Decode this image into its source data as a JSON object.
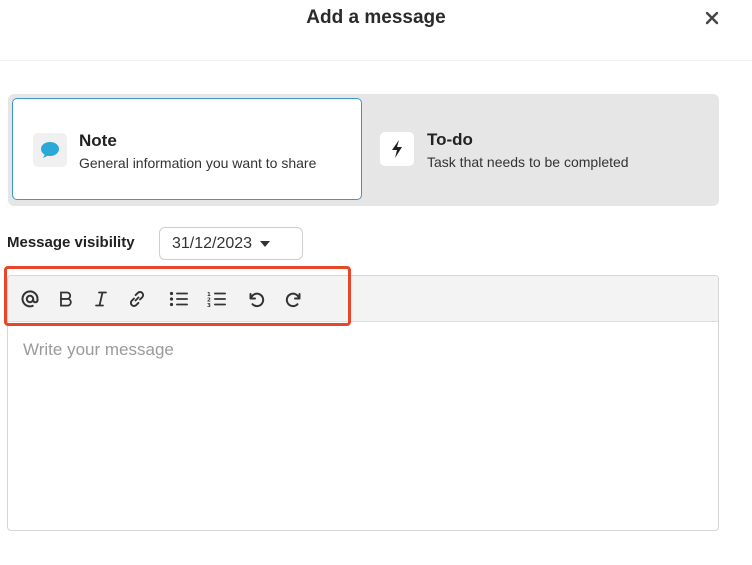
{
  "dialog": {
    "title": "Add a message",
    "close_icon": "close-icon"
  },
  "message_types": [
    {
      "title": "Note",
      "description": "General information you want to share",
      "icon": "speech-bubble-icon",
      "selected": true,
      "icon_color": "#2aa8d8"
    },
    {
      "title": "To-do",
      "description": "Task that needs to be completed",
      "icon": "lightning-bolt-icon",
      "selected": false
    }
  ],
  "visibility": {
    "label": "Message visibility",
    "date": "31/12/2023"
  },
  "editor": {
    "toolbar": [
      "mention-icon",
      "bold-icon",
      "italic-icon",
      "link-icon",
      "bullet-list-icon",
      "numbered-list-icon",
      "undo-icon",
      "redo-icon"
    ],
    "placeholder": "Write your message"
  },
  "colors": {
    "selected_border": "#3f97c9",
    "highlight": "#e8462a"
  }
}
